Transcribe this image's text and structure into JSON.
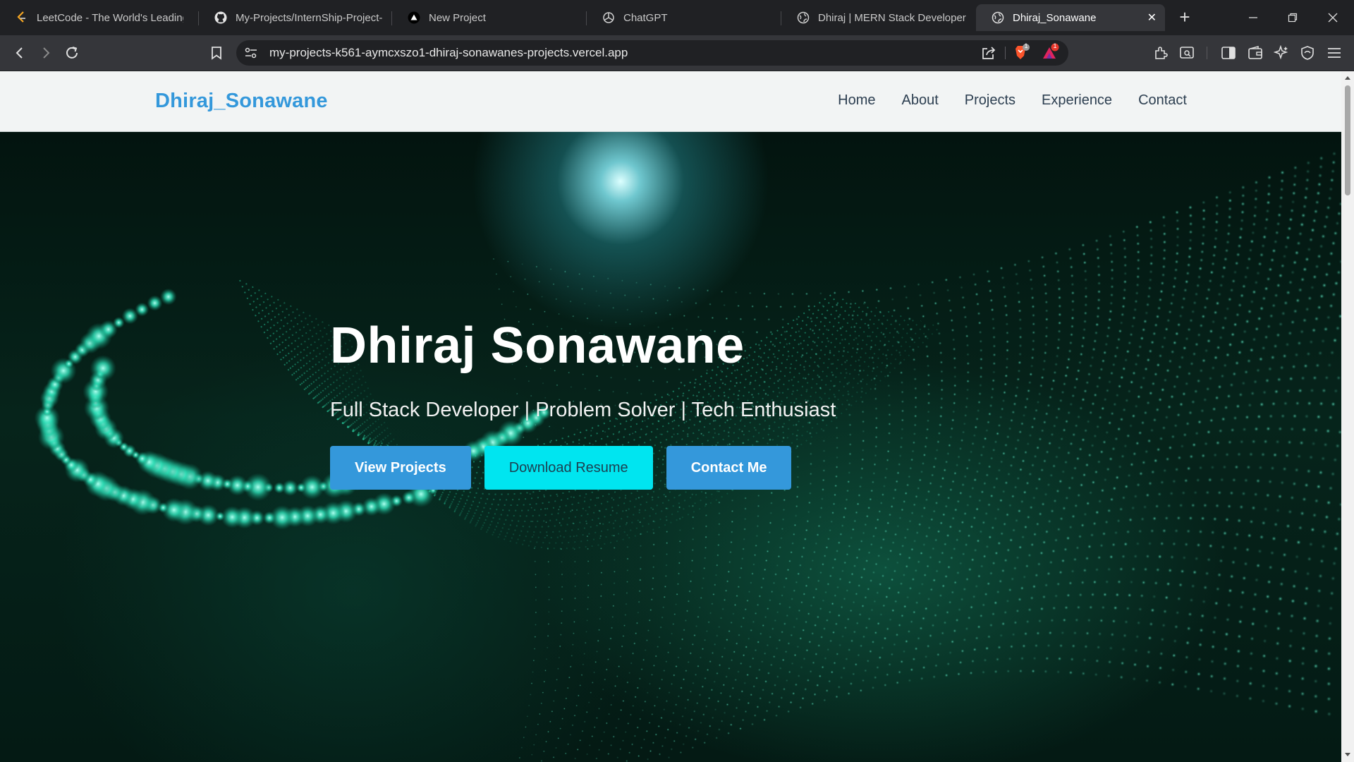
{
  "browser": {
    "tabs": [
      {
        "title": "LeetCode - The World's Leading",
        "icon": "leetcode-icon"
      },
      {
        "title": "My-Projects/InternShip-Project-",
        "icon": "github-icon"
      },
      {
        "title": "New Project",
        "icon": "vercel-icon"
      },
      {
        "title": "ChatGPT",
        "icon": "chatgpt-icon"
      },
      {
        "title": "Dhiraj | MERN Stack Developer",
        "icon": "globe-icon"
      },
      {
        "title": "Dhiraj_Sonawane",
        "icon": "globe-icon",
        "active": true
      }
    ],
    "url": "my-projects-k561-aymcxszo1-dhiraj-sonawanes-projects.vercel.app",
    "shield_badge": "1",
    "alert_badge": "1",
    "colors": {
      "tabstrip": "#202124",
      "toolbar": "#35363a"
    }
  },
  "site": {
    "brand": "Dhiraj_Sonawane",
    "nav": [
      "Home",
      "About",
      "Projects",
      "Experience",
      "Contact"
    ],
    "hero": {
      "title": "Dhiraj Sonawane",
      "subtitle": "Full Stack Developer | Problem Solver | Tech Enthusiast",
      "buttons": {
        "projects": "View Projects",
        "resume": "Download Resume",
        "contact": "Contact Me"
      }
    },
    "colors": {
      "brand": "#3498db",
      "primary_button": "#3498db",
      "resume_button": "#00e5f0",
      "nav_text": "#2c3e50"
    }
  }
}
